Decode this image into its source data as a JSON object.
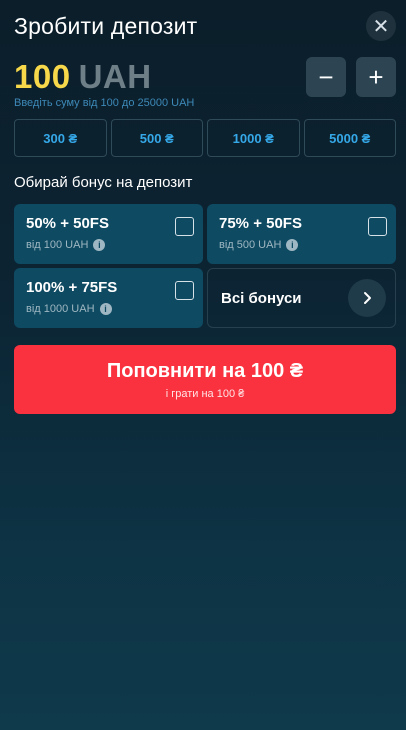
{
  "header": {
    "title": "Зробити депозит",
    "close_icon": "close-icon"
  },
  "amount": {
    "value": "100",
    "currency": "UAH",
    "hint": "Введіть суму від 100 до 25000 UAH",
    "minus": "−",
    "plus": "+"
  },
  "presets": [
    "300 ₴",
    "500 ₴",
    "1000 ₴",
    "5000 ₴"
  ],
  "bonus": {
    "title": "Обирай бонус на депозит",
    "cards": [
      {
        "name": "50% + 50FS",
        "sub": "від 100 UAH"
      },
      {
        "name": "75% + 50FS",
        "sub": "від 500 UAH"
      },
      {
        "name": "100% + 75FS",
        "sub": "від 1000 UAH"
      }
    ],
    "all_label": "Всі бонуси"
  },
  "deposit": {
    "label": "Поповнити на 100 ₴",
    "sub": "і грати на 100 ₴"
  },
  "colors": {
    "accent_yellow": "#f7d84a",
    "deposit_red": "#fa323f",
    "preset_blue": "#35a8e8",
    "card_bg": "#0e4a62"
  }
}
